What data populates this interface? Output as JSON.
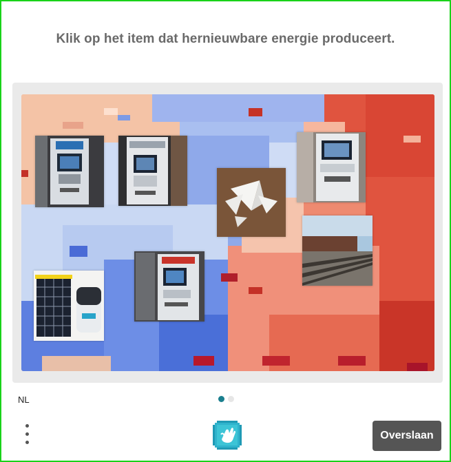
{
  "prompt": "Klik op het item dat hernieuwbare energie produceert.",
  "footer": {
    "language": "NL",
    "skip_label": "Overslaan",
    "pagination": {
      "total": 2,
      "active": 1
    }
  },
  "challenge": {
    "tiles": [
      {
        "name": "tile-atm-1",
        "subject": "atm"
      },
      {
        "name": "tile-atm-2",
        "subject": "atm"
      },
      {
        "name": "tile-paper-planes",
        "subject": "paper-planes"
      },
      {
        "name": "tile-atm-3",
        "subject": "atm"
      },
      {
        "name": "tile-train-tracks",
        "subject": "train-tracks"
      },
      {
        "name": "tile-solar-panel-battery",
        "subject": "solar-panel"
      },
      {
        "name": "tile-atm-4",
        "subject": "atm"
      }
    ]
  },
  "colors": {
    "accent": "#1a7f8e",
    "skip_button": "#555555",
    "frame_border": "#19d219",
    "dot_active": "#1a7f8e",
    "dot_inactive": "#e6e6e6"
  },
  "icons": {
    "menu": "kebab-menu-icon",
    "logo": "hand-logo-icon"
  }
}
